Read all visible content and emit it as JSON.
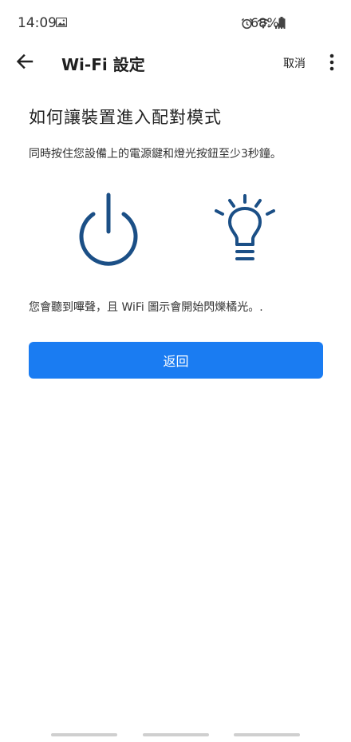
{
  "status_bar": {
    "time": "14:09",
    "battery": "68%",
    "icons": [
      "image-icon",
      "alarm-icon",
      "wifi-icon",
      "signal-icon",
      "battery-icon"
    ]
  },
  "app_bar": {
    "title": "Wi-Fi 設定",
    "cancel_label": "取消",
    "icons": [
      "back-arrow-icon",
      "overflow-menu-icon"
    ]
  },
  "content": {
    "heading": "如何讓裝置進入配對模式",
    "instruction": "同時按住您設備上的電源鍵和燈光按鈕至少3秒鐘。",
    "note": "您會聽到嗶聲，且 WiFi 圖示會開始閃爍橘光。.",
    "icons": [
      "power-icon",
      "light-bulb-icon"
    ],
    "icon_color": "#1b4f86"
  },
  "actions": {
    "back_label": "返回",
    "back_color": "#1a7cf2"
  }
}
